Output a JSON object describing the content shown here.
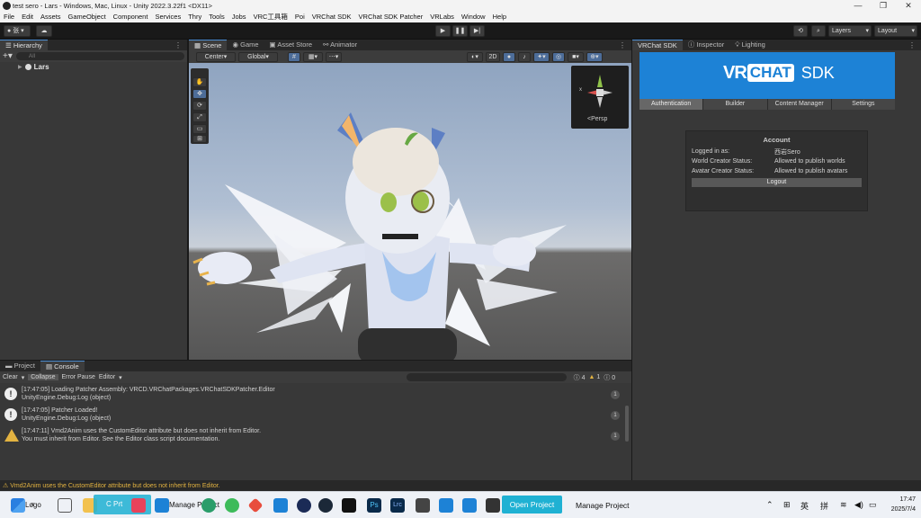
{
  "window": {
    "title": "test sero - Lars - Windows, Mac, Linux - Unity 2022.3.22f1 <DX11>"
  },
  "menu": [
    "File",
    "Edit",
    "Assets",
    "GameObject",
    "Component",
    "Services",
    "Thry",
    "Tools",
    "Jobs",
    "VRC工具箱",
    "Poi",
    "VRChat SDK",
    "VRChat SDK Patcher",
    "VRLabs",
    "Window",
    "Help"
  ],
  "toolbar": {
    "account_label": "张",
    "layers_label": "Layers",
    "layout_label": "Layout"
  },
  "hierarchy": {
    "tab": "Hierarchy",
    "search_placeholder": "All",
    "root_item": "Lars"
  },
  "scene": {
    "tabs": [
      "Scene",
      "Game",
      "Asset Store",
      "Animator"
    ],
    "pivot": "Center",
    "space": "Global",
    "mode_2d": "2D",
    "persp_label": "<Persp",
    "gizmo_x": "x"
  },
  "right_panel": {
    "tabs": [
      "VRChat SDK",
      "Inspector",
      "Lighting"
    ],
    "logo_vr": "VR",
    "logo_chat": "CHAT",
    "logo_sdk": "SDK",
    "nav": [
      "Authentication",
      "Builder",
      "Content Manager",
      "Settings"
    ],
    "account": {
      "header": "Account",
      "rows": [
        {
          "label": "Logged in as:",
          "value": "西岩Sero"
        },
        {
          "label": "World Creator Status:",
          "value": "Allowed to publish worlds"
        },
        {
          "label": "Avatar Creator Status:",
          "value": "Allowed to publish avatars"
        }
      ],
      "logout": "Logout"
    }
  },
  "console": {
    "tabs": [
      "Project",
      "Console"
    ],
    "buttons": [
      "Clear",
      "Collapse",
      "Error Pause",
      "Editor"
    ],
    "counts": {
      "info": "4",
      "warn": "1",
      "error": "0"
    },
    "entries": [
      {
        "type": "info",
        "line1": "[17:47:05] Loading Patcher Assembly: VRCD.VRChatPackages.VRChatSDKPatcher.Editor",
        "line2": "UnityEngine.Debug:Log (object)",
        "count": "1"
      },
      {
        "type": "info",
        "line1": "[17:47:05] Patcher Loaded!",
        "line2": "UnityEngine.Debug:Log (object)",
        "count": "1"
      },
      {
        "type": "warn",
        "line1": "[17:47:11] Vmd2Anim uses the CustomEditor attribute but does not inherit from Editor.",
        "line2": "You must inherit from Editor. See the Editor class script documentation.",
        "count": "1"
      }
    ]
  },
  "status_bar": {
    "message": "Vmd2Anim uses the CustomEditor attribute but does not inherit from Editor."
  },
  "taskbar": {
    "search_label": "Logo",
    "item_prt": "C Prt",
    "item_manage": "Manage Project",
    "open_project": "Open Project",
    "manage_project": "Manage Project",
    "ime_en": "英",
    "ime_pin": "拼",
    "time": "17:47",
    "date": "2025/7/4"
  },
  "colors": {
    "accent": "#4d8fd4",
    "vrchat_blue": "#1d82d6",
    "warning": "#e3b341",
    "open_project": "#1fb1d3"
  }
}
